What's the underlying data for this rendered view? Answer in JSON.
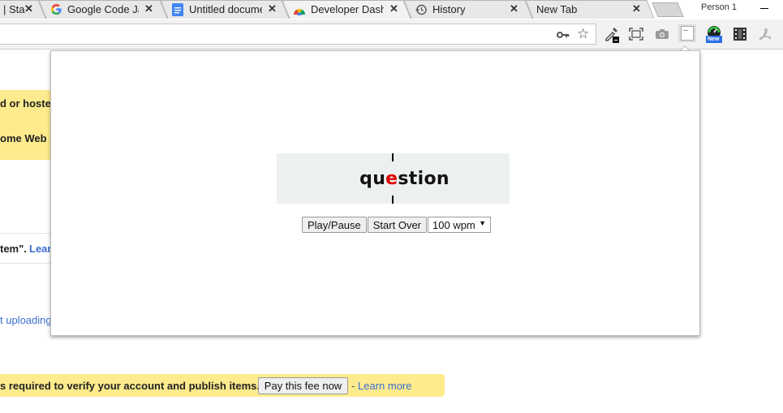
{
  "tabs": [
    {
      "title": "| Sta",
      "favicon": "doc-icon"
    },
    {
      "title": "Google Code Jam",
      "favicon": "google-g-icon"
    },
    {
      "title": "Untitled docume",
      "favicon": "google-docs-icon"
    },
    {
      "title": "Developer Dashb",
      "favicon": "chrome-webstore-icon"
    },
    {
      "title": "History",
      "favicon": "history-icon"
    },
    {
      "title": "New Tab",
      "favicon": ""
    }
  ],
  "profile_name": "Person 1",
  "extensions": [
    "eyedropper-icon",
    "capture-icon",
    "camera-icon",
    "speed-reader-icon",
    "gauge-icon",
    "film-icon",
    "pdf-icon"
  ],
  "new_badge": "New",
  "background": {
    "line1": "d or hoste",
    "line2": "ome Web S",
    "line3_bold": "tem\".",
    "line3_link": "Lear",
    "line4_link": "t uploading",
    "fee_text": "s required to verify your account and publish items.",
    "fee_button": "Pay this fee now",
    "fee_dash": "-",
    "fee_link": "Learn more"
  },
  "reader": {
    "word_prefix": "qu",
    "word_focus": "e",
    "word_suffix": "stion",
    "play_pause": "Play/Pause",
    "start_over": "Start Over",
    "speed": "100 wpm"
  },
  "colors": {
    "banner": "#fdeb8d",
    "focus_letter": "#e00000",
    "link": "#3b6fd1",
    "reader_bg": "#ecf0f0"
  }
}
